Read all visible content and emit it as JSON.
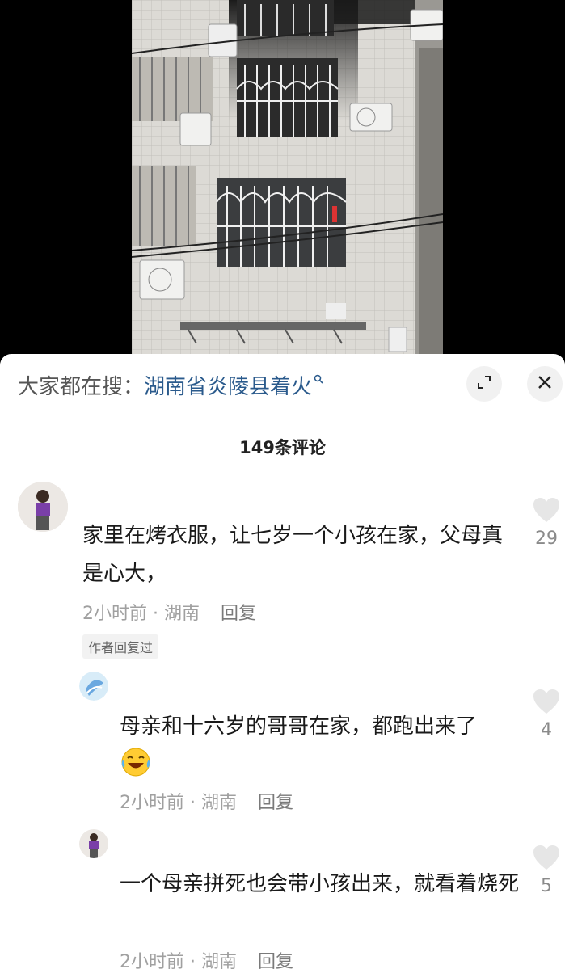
{
  "search": {
    "prefix": "大家都在搜：",
    "term": "湖南省炎陵县着火"
  },
  "comments_header": {
    "title": "149条评论"
  },
  "comments": [
    {
      "text": "家里在烤衣服，让七岁一个小孩在家，父母真是心大，",
      "time": "2小时前",
      "location": "湖南",
      "reply_label": "回复",
      "tag": "作者回复过",
      "likes": "29"
    },
    {
      "text": "母亲和十六岁的哥哥在家，都跑出来了",
      "emoji": "laughing-crying-emoji",
      "time": "2小时前",
      "location": "湖南",
      "reply_label": "回复",
      "likes": "4"
    },
    {
      "text": "一个母亲拼死也会带小孩出来，就看着烧死",
      "time": "2小时前",
      "location": "湖南",
      "reply_label": "回复",
      "likes": "5"
    }
  ],
  "colors": {
    "search_term": "#2a5a8c",
    "meta": "#a0a0a0",
    "sheet_bg": "#ffffff",
    "video_bg": "#000000"
  },
  "icons": [
    "search-icon",
    "expand-icon",
    "close-icon",
    "heart-icon",
    "avatar"
  ]
}
